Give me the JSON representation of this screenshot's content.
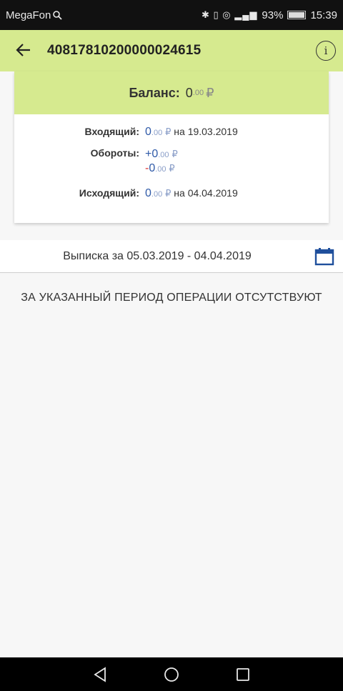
{
  "status_bar": {
    "carrier": "MegaFon",
    "battery": "93%",
    "time": "15:39"
  },
  "app_bar": {
    "account_number": "40817810200000024615"
  },
  "summary": {
    "balance_label": "Баланс:",
    "balance_main": "0",
    "balance_fraction": ".00",
    "currency": "₽",
    "incoming_label": "Входящий:",
    "incoming_main": "0",
    "incoming_fraction": ".00",
    "incoming_date_prefix": "на",
    "incoming_date": "19.03.2019",
    "turnover_label": "Обороты:",
    "turnover_plus_sign": "+",
    "turnover_plus_main": "0",
    "turnover_plus_fraction": ".00",
    "turnover_minus_sign": "-",
    "turnover_minus_main": "0",
    "turnover_minus_fraction": ".00",
    "outgoing_label": "Исходящий:",
    "outgoing_main": "0",
    "outgoing_fraction": ".00",
    "outgoing_date_prefix": "на",
    "outgoing_date": "04.04.2019"
  },
  "statement": {
    "period_text": "Выписка за 05.03.2019 - 04.04.2019",
    "empty_message": "ЗА УКАЗАННЫЙ ПЕРИОД ОПЕРАЦИИ ОТСУТСТВУЮТ"
  },
  "icons": {
    "back": "arrow-left-icon",
    "info": "info-icon",
    "calendar": "calendar-icon",
    "nav_back": "triangle-back-icon",
    "nav_home": "circle-home-icon",
    "nav_recent": "square-recent-icon"
  },
  "colors": {
    "accent_green": "#d6ea8f",
    "amount_blue": "#2f5aa8",
    "negative_red": "#dd3333",
    "calendar_blue": "#1f4f9c"
  }
}
